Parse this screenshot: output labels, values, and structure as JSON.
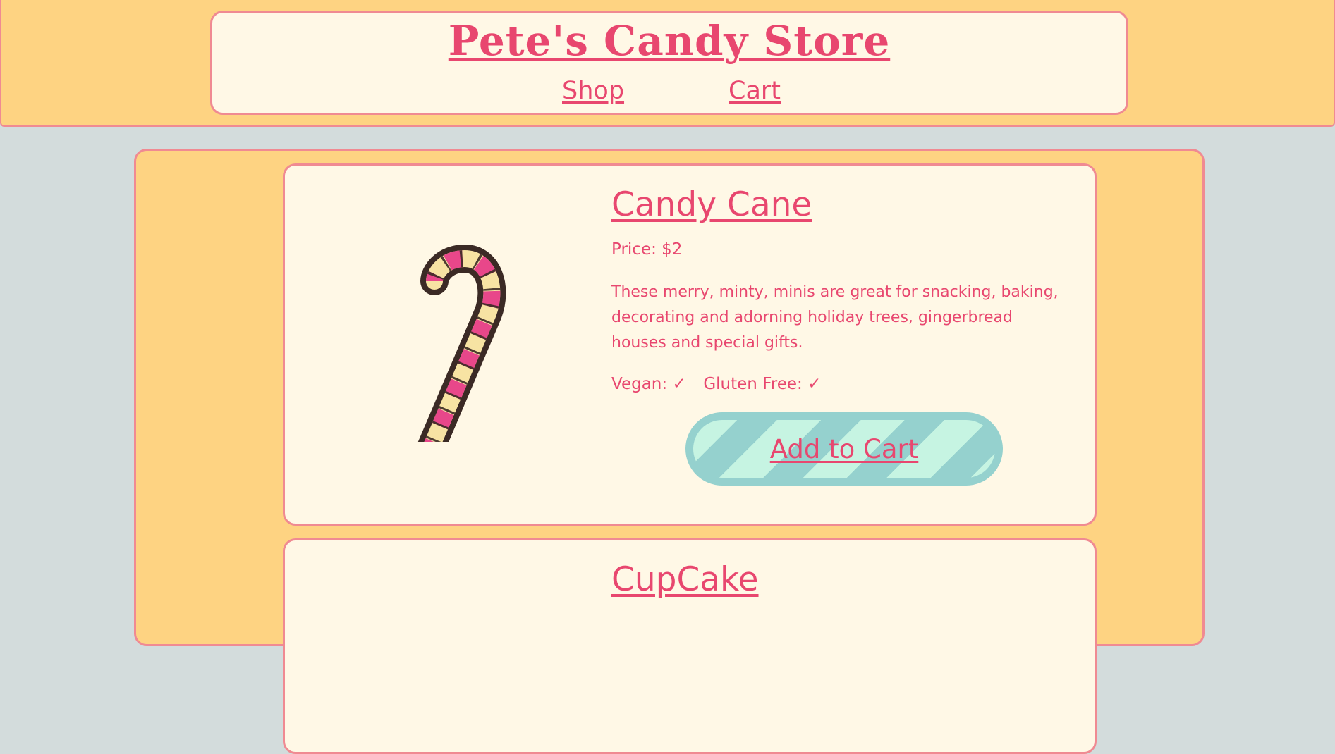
{
  "header": {
    "title": "Pete's Candy Store",
    "nav": {
      "shop": "Shop",
      "cart": "Cart"
    }
  },
  "products": [
    {
      "name": "Candy Cane",
      "price": "Price: $2",
      "description": "These merry, minty, minis are great for snacking, baking, decorating and adorning holiday trees, gingerbread houses and special gifts.",
      "vegan_label": "Vegan:",
      "vegan_mark": "✓",
      "gluten_label": "Gluten Free:",
      "gluten_mark": "✓",
      "button": "Add to Cart",
      "image_icon": "candy-cane-icon"
    },
    {
      "name": "CupCake"
    }
  ],
  "colors": {
    "accent": "#e8476f",
    "border": "#f08a92",
    "panel": "#fed382",
    "card": "#fff8e6",
    "page_bg": "#d3dcdc",
    "button_teal": "#95d1ce",
    "button_mint": "#c6f4e2"
  }
}
